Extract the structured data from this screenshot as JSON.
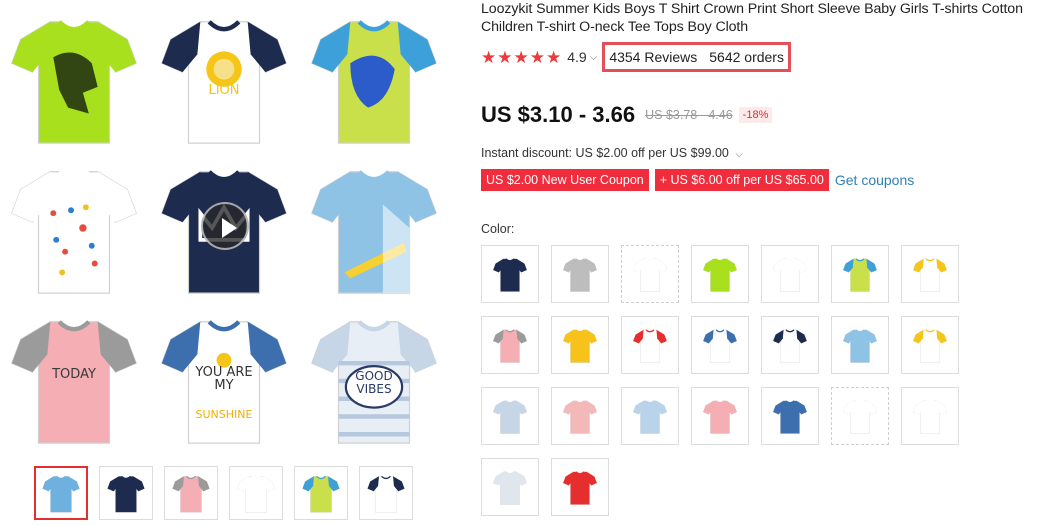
{
  "product": {
    "title": "Loozykit Summer Kids Boys T Shirt Crown Print Short Sleeve Baby Girls T-shirts Cotton Children T-shirt O-neck Tee Tops Boy Cloth",
    "rating": "4.9",
    "reviews": "4354 Reviews",
    "orders": "5642 orders",
    "price": "US $3.10 - 3.66",
    "old_price": "US $3.78 - 4.46",
    "discount": "-18%",
    "instant_discount": "Instant discount: US $2.00 off per US $99.00",
    "coupons": [
      "US $2.00 New User Coupon",
      "+ US $6.00 off per US $65.00"
    ],
    "get_coupons": "Get coupons",
    "color_label": "Color:"
  },
  "gallery": {
    "main_tees": [
      {
        "name": "dinosaur-tee",
        "body": "#a8e01e",
        "sleeve": "#a8e01e",
        "print": "#1c2a10",
        "text": ""
      },
      {
        "name": "lion-tee",
        "body": "#ffffff",
        "sleeve": "#1d2b4f",
        "print": "#f5c518",
        "text": "LION"
      },
      {
        "name": "blue-dino-tee",
        "body": "#c9e04a",
        "sleeve": "#3ea0d8",
        "print": "#2c5cc9",
        "text": ""
      },
      {
        "name": "paint-splatter-tee",
        "body": "#ffffff",
        "sleeve": "#ffffff",
        "print": "#e64b3c",
        "text": ""
      },
      {
        "name": "crown-tee",
        "body": "#1d2b4f",
        "sleeve": "#1d2b4f",
        "print": "#ffffff",
        "text": ""
      },
      {
        "name": "surf-tee",
        "body": "#8fc3e6",
        "sleeve": "#8fc3e6",
        "print": "#ffffff",
        "text": ""
      },
      {
        "name": "today-tee",
        "body": "#f4aeb4",
        "sleeve": "#9b9b9b",
        "print": "#3a3a3a",
        "text": "TODAY"
      },
      {
        "name": "sunshine-tee",
        "body": "#ffffff",
        "sleeve": "#3d6fae",
        "print": "#333333",
        "text": "YOU ARE MY"
      },
      {
        "name": "good-vibes-tee",
        "body": "#e8eef5",
        "sleeve": "#c7d6e6",
        "print": "#2a3a66",
        "text": "GOOD VIBES"
      }
    ],
    "sunshine_word": "SUNSHINE",
    "video_icon": "play-icon",
    "thumbnails": [
      {
        "body": "#6fb1de",
        "sleeve": "#6fb1de"
      },
      {
        "body": "#1d2b4f",
        "sleeve": "#1d2b4f"
      },
      {
        "body": "#f4aeb4",
        "sleeve": "#9b9b9b"
      },
      {
        "body": "#ffffff",
        "sleeve": "#ffffff"
      },
      {
        "body": "#c9e04a",
        "sleeve": "#3ea0d8"
      },
      {
        "body": "#ffffff",
        "sleeve": "#1d2b4f"
      }
    ]
  },
  "swatches": [
    {
      "body": "#1d2b4f",
      "sleeve": "#1d2b4f",
      "dashed": false
    },
    {
      "body": "#bdbdbd",
      "sleeve": "#bdbdbd",
      "dashed": false
    },
    {
      "body": "#ffffff",
      "sleeve": "#ffffff",
      "dashed": true
    },
    {
      "body": "#a8e01e",
      "sleeve": "#a8e01e",
      "dashed": false
    },
    {
      "body": "#ffffff",
      "sleeve": "#ffffff",
      "dashed": false
    },
    {
      "body": "#c9e04a",
      "sleeve": "#3ea0d8",
      "dashed": false
    },
    {
      "body": "#ffffff",
      "sleeve": "#f5c518",
      "dashed": false
    },
    {
      "body": "#f4aeb4",
      "sleeve": "#9b9b9b",
      "dashed": false
    },
    {
      "body": "#f7c31a",
      "sleeve": "#f7c31a",
      "dashed": false
    },
    {
      "body": "#ffffff",
      "sleeve": "#e62e2e",
      "dashed": false
    },
    {
      "body": "#ffffff",
      "sleeve": "#3d6fae",
      "dashed": false
    },
    {
      "body": "#ffffff",
      "sleeve": "#1d2b4f",
      "dashed": false
    },
    {
      "body": "#8fc3e6",
      "sleeve": "#8fc3e6",
      "dashed": false
    },
    {
      "body": "#ffffff",
      "sleeve": "#f5c518",
      "dashed": false
    },
    {
      "body": "#c7d6e6",
      "sleeve": "#c7d6e6",
      "dashed": false
    },
    {
      "body": "#f3b9b9",
      "sleeve": "#f3b9b9",
      "dashed": false
    },
    {
      "body": "#b9d3ea",
      "sleeve": "#b9d3ea",
      "dashed": false
    },
    {
      "body": "#f4aeb4",
      "sleeve": "#f4aeb4",
      "dashed": false
    },
    {
      "body": "#3d6fae",
      "sleeve": "#3d6fae",
      "dashed": false
    },
    {
      "body": "#ffffff",
      "sleeve": "#ffffff",
      "dashed": true
    },
    {
      "body": "#ffffff",
      "sleeve": "#ffffff",
      "dashed": false
    },
    {
      "body": "#e0e6ee",
      "sleeve": "#e0e6ee",
      "dashed": false
    },
    {
      "body": "#e62e2e",
      "sleeve": "#e62e2e",
      "dashed": false
    }
  ]
}
